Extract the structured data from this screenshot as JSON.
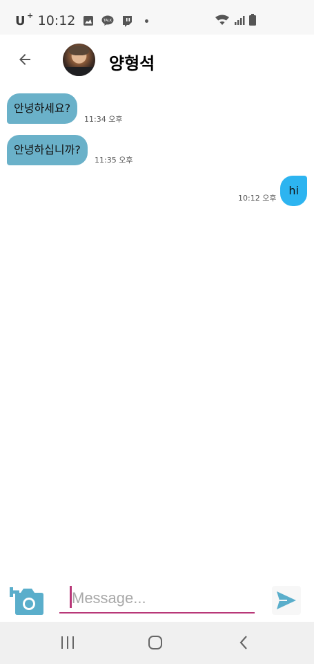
{
  "status_bar": {
    "carrier": "U",
    "carrier_sup": "+",
    "time": "10:12"
  },
  "header": {
    "contact_name": "양형석"
  },
  "messages": [
    {
      "text": "안녕하세요?",
      "time": "11:34 오후",
      "direction": "incoming"
    },
    {
      "text": "안녕하십니까?",
      "time": "11:35 오후",
      "direction": "incoming"
    },
    {
      "text": "hi",
      "time": "10:12 오후",
      "direction": "outgoing"
    }
  ],
  "composer": {
    "placeholder": "Message...",
    "value": ""
  },
  "colors": {
    "incoming_bubble": "#6ab1c9",
    "outgoing_bubble": "#2db4f0",
    "accent": "#b83778",
    "send_icon": "#5aaecb"
  },
  "icons": {
    "back": "arrow-left-icon",
    "camera": "camera-plus-icon",
    "send": "send-icon",
    "nav_recent": "recents-icon",
    "nav_home": "home-icon",
    "nav_back": "chevron-left-icon"
  }
}
